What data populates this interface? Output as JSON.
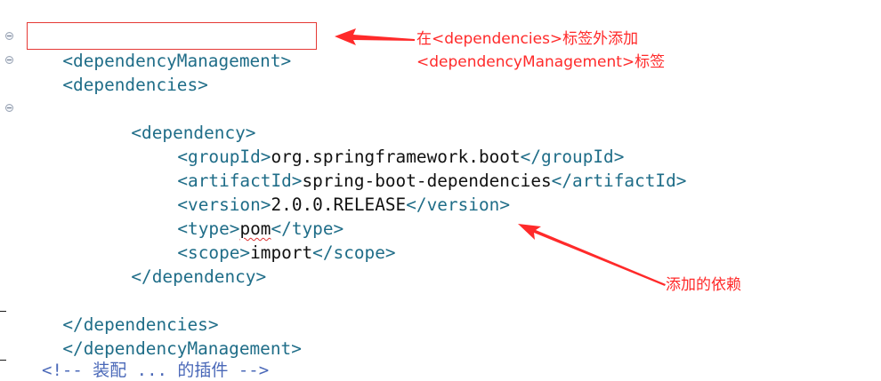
{
  "editor": {
    "lines": [
      {
        "open": "<",
        "name": "dependencyManagement",
        "close": ">"
      },
      {
        "open": "<",
        "name": "dependencies",
        "close": ">"
      },
      {
        "open": "<",
        "name": "dependency",
        "close": ">"
      },
      {
        "open": "<",
        "name": "groupId",
        "close": ">",
        "value": "org.springframework.boot",
        "end_open": "</",
        "end_name": "groupId",
        "end_close": ">"
      },
      {
        "open": "<",
        "name": "artifactId",
        "close": ">",
        "value": "spring-boot-dependencies",
        "end_open": "</",
        "end_name": "artifactId",
        "end_close": ">"
      },
      {
        "open": "<",
        "name": "version",
        "close": ">",
        "value": "2.0.0.RELEASE",
        "end_open": "</",
        "end_name": "version",
        "end_close": ">"
      },
      {
        "open": "<",
        "name": "type",
        "close": ">",
        "value": "pom",
        "end_open": "</",
        "end_name": "type",
        "end_close": ">"
      },
      {
        "open": "<",
        "name": "scope",
        "close": ">",
        "value": "import",
        "end_open": "</",
        "end_name": "scope",
        "end_close": ">"
      },
      {
        "open": "</",
        "name": "dependency",
        "close": ">"
      },
      {
        "open": "</",
        "name": "dependencies",
        "close": ">"
      },
      {
        "open": "</",
        "name": "dependencyManagement",
        "close": ">"
      }
    ],
    "cutoff_text": "<!-- 装配 ... 的插件 -->"
  },
  "annotations": {
    "top_line1": "在<dependencies>标签外添加",
    "top_line2": "<dependencyManagement>标签",
    "bottom": "添加的依赖"
  },
  "colors": {
    "tag": "#1f6d88",
    "text": "#111111",
    "annotation": "#ff2a2a"
  }
}
